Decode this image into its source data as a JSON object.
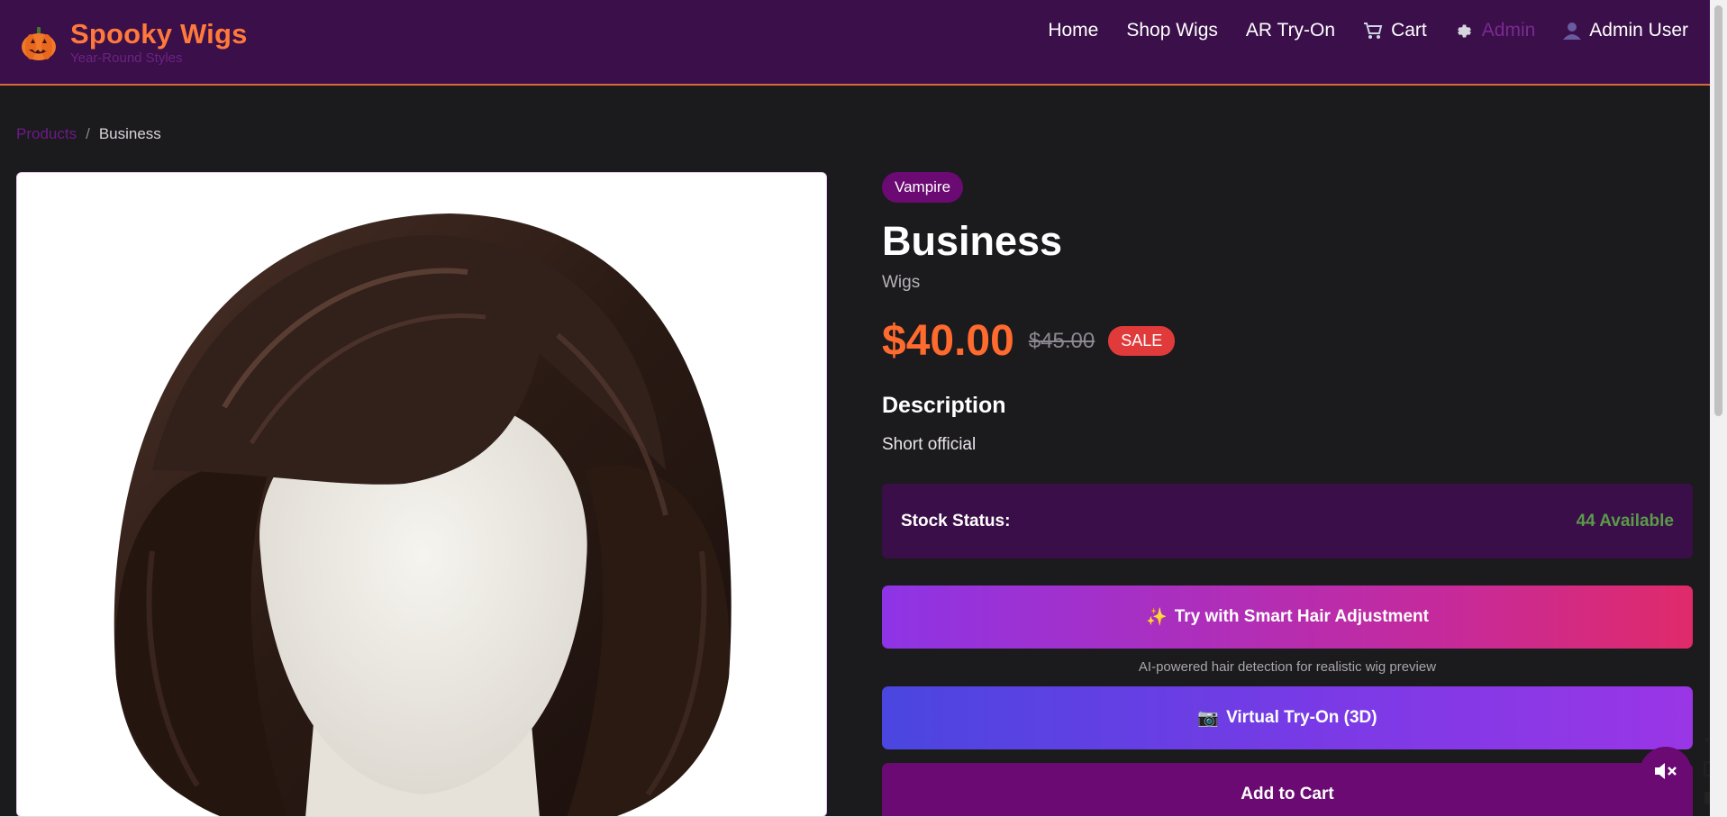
{
  "header": {
    "brand_title": "Spooky Wigs",
    "brand_subtitle": "Year-Round Styles",
    "nav": {
      "home": "Home",
      "shop": "Shop Wigs",
      "ar": "AR Try-On",
      "cart": "Cart",
      "admin": "Admin",
      "user": "Admin User"
    },
    "icons": {
      "logo": "pumpkin-icon",
      "cart": "cart-icon",
      "admin": "gear-icon",
      "user": "user-icon"
    }
  },
  "breadcrumb": {
    "parent": "Products",
    "separator": "/",
    "current": "Business"
  },
  "product": {
    "tag": "Vampire",
    "title": "Business",
    "category": "Wigs",
    "price": "$40.00",
    "original_price": "$45.00",
    "sale_badge": "SALE",
    "description_heading": "Description",
    "description": "Short official",
    "stock_label": "Stock Status:",
    "stock_value": "44 Available"
  },
  "actions": {
    "smart_emoji": "✨",
    "smart_label": "Try with Smart Hair Adjustment",
    "smart_note": "AI-powered hair detection for realistic wig preview",
    "vto_emoji": "📷",
    "vto_label": "Virtual Try-On (3D)",
    "cart_label": "Add to Cart"
  },
  "colors": {
    "header_bg": "#3a0f4a",
    "brand": "#ff7a3a",
    "price": "#ff6a2e",
    "accent_purple": "#6a0a72",
    "stock_ok": "#5a9a4a",
    "sale": "#e03a3a"
  }
}
